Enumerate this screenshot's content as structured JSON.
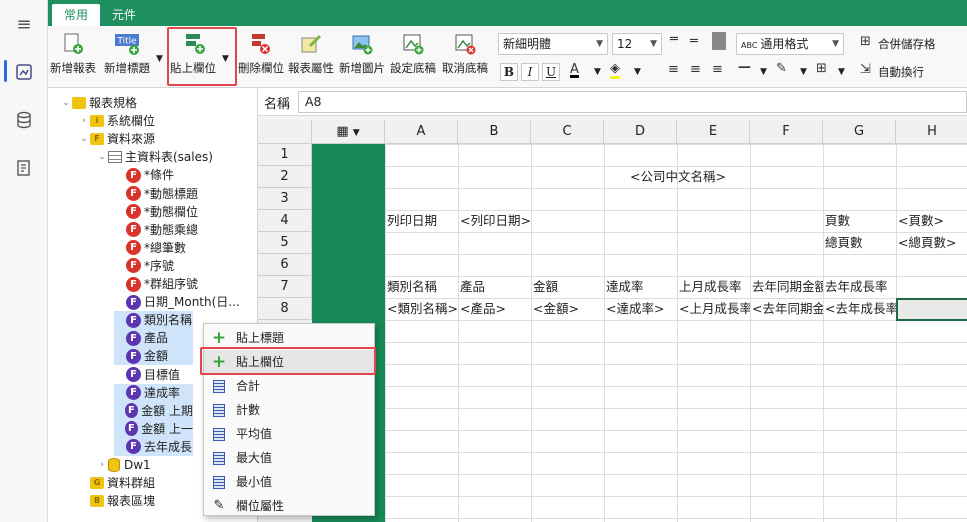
{
  "rail": {
    "items": [
      "menu-icon",
      "report-icon",
      "database-icon",
      "document-icon"
    ]
  },
  "tabs": [
    "常用",
    "元件"
  ],
  "ribbon": {
    "new_report": "新增報表",
    "new_title": "新增標題",
    "paste_field": "貼上欄位",
    "delete_field": "刪除欄位",
    "report_properties": "報表屬性",
    "new_image": "新增圖片",
    "set_background": "設定底稿",
    "cancel_background": "取消底稿",
    "font": "新細明體",
    "font_size": "12",
    "number_format": "通用格式",
    "merge_cells": "合併儲存格",
    "wrap_text": "自動換行",
    "bold": "B",
    "italic": "I",
    "underline": "U",
    "font_color": "A"
  },
  "tree": [
    {
      "label": "報表規格",
      "kind": "folder",
      "indent": 0
    },
    {
      "label": "系統欄位",
      "kind": "folder-i",
      "indent": 1
    },
    {
      "label": "資料來源",
      "kind": "folder-f",
      "indent": 1
    },
    {
      "label": "主資料表(sales)",
      "kind": "table",
      "indent": 2
    },
    {
      "label": "*條件",
      "kind": "f-red",
      "indent": 3
    },
    {
      "label": "*動態標題",
      "kind": "f-red",
      "indent": 3
    },
    {
      "label": "*動態欄位",
      "kind": "f-red",
      "indent": 3
    },
    {
      "label": "*動態乘總",
      "kind": "f-red",
      "indent": 3
    },
    {
      "label": "*總筆數",
      "kind": "f-red",
      "indent": 3
    },
    {
      "label": "*序號",
      "kind": "f-red",
      "indent": 3
    },
    {
      "label": "*群組序號",
      "kind": "f-red",
      "indent": 3
    },
    {
      "label": "日期_Month(日...",
      "kind": "f-purple",
      "indent": 3
    },
    {
      "label": "類別名稱",
      "kind": "f-purple",
      "indent": 3,
      "sel": true
    },
    {
      "label": "產品",
      "kind": "f-purple",
      "indent": 3,
      "sel": true
    },
    {
      "label": "金額",
      "kind": "f-purple",
      "indent": 3,
      "sel": true
    },
    {
      "label": "目標值",
      "kind": "f-purple",
      "indent": 3
    },
    {
      "label": "達成率",
      "kind": "f-purple",
      "indent": 3,
      "sel": true
    },
    {
      "label": "金額 上期",
      "kind": "f-purple",
      "indent": 3,
      "sel": true
    },
    {
      "label": "金額 上一",
      "kind": "f-purple",
      "indent": 3,
      "sel": true
    },
    {
      "label": "去年成長",
      "kind": "f-purple",
      "indent": 3,
      "sel": true
    },
    {
      "label": "Dw1",
      "kind": "db",
      "indent": 2
    },
    {
      "label": "資料群組",
      "kind": "folder-g",
      "indent": 1
    },
    {
      "label": "報表區塊",
      "kind": "folder-b",
      "indent": 1
    }
  ],
  "context_menu": [
    {
      "label": "貼上標題",
      "icon": "plus-icon"
    },
    {
      "label": "貼上欄位",
      "icon": "plus-icon",
      "highlight": true
    },
    {
      "label": "合計",
      "icon": "grid-icon"
    },
    {
      "label": "計數",
      "icon": "grid-icon"
    },
    {
      "label": "平均值",
      "icon": "grid-icon"
    },
    {
      "label": "最大值",
      "icon": "grid-icon"
    },
    {
      "label": "最小值",
      "icon": "grid-icon"
    },
    {
      "label": "欄位屬性",
      "icon": "edit-icon"
    }
  ],
  "namebar": {
    "label": "名稱",
    "value": "A8"
  },
  "sheet": {
    "columns": [
      "A",
      "B",
      "C",
      "D",
      "E",
      "F",
      "G",
      "H"
    ],
    "rows": [
      "1",
      "2",
      "3",
      "4",
      "5",
      "6",
      "7",
      "8"
    ],
    "cells": [
      {
        "row": 2,
        "col": 0,
        "span": 8,
        "center": true,
        "text": "<公司中文名稱>"
      },
      {
        "row": 4,
        "col": 0,
        "text": "列印日期"
      },
      {
        "row": 4,
        "col": 1,
        "text": "<列印日期>"
      },
      {
        "row": 4,
        "col": 6,
        "text": "頁數"
      },
      {
        "row": 4,
        "col": 7,
        "text": "<頁數>"
      },
      {
        "row": 5,
        "col": 6,
        "text": "總頁數"
      },
      {
        "row": 5,
        "col": 7,
        "text": "<總頁數>"
      },
      {
        "row": 7,
        "col": 0,
        "text": "類別名稱"
      },
      {
        "row": 7,
        "col": 1,
        "text": "產品"
      },
      {
        "row": 7,
        "col": 2,
        "text": "金額"
      },
      {
        "row": 7,
        "col": 3,
        "text": "達成率"
      },
      {
        "row": 7,
        "col": 4,
        "text": "上月成長率"
      },
      {
        "row": 7,
        "col": 5,
        "text": "去年同期金額"
      },
      {
        "row": 7,
        "col": 6,
        "text": "去年成長率"
      },
      {
        "row": 8,
        "col": 0,
        "text": "<類別名稱>"
      },
      {
        "row": 8,
        "col": 1,
        "text": "<產品>"
      },
      {
        "row": 8,
        "col": 2,
        "text": "<金額>"
      },
      {
        "row": 8,
        "col": 3,
        "text": "<達成率>"
      },
      {
        "row": 8,
        "col": 4,
        "text": "<上月成長率>"
      },
      {
        "row": 8,
        "col": 5,
        "text": "<去年同期金額>"
      },
      {
        "row": 8,
        "col": 6,
        "text": "<去年成長率>"
      }
    ],
    "selected": {
      "row": 8,
      "col": 7
    }
  }
}
